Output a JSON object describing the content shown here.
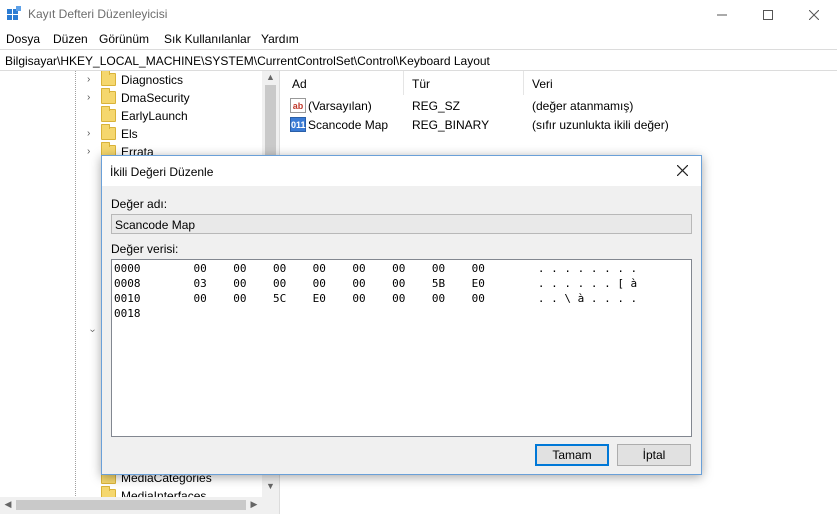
{
  "window": {
    "title": "Kayıt Defteri Düzenleyicisi",
    "controls": [
      "minimize-icon",
      "maximize-icon",
      "close-icon"
    ]
  },
  "menu": [
    "Dosya",
    "Düzen",
    "Görünüm",
    "Sık Kullanılanlar",
    "Yardım"
  ],
  "address": "Bilgisayar\\HKEY_LOCAL_MACHINE\\SYSTEM\\CurrentControlSet\\Control\\Keyboard Layout",
  "tree": {
    "items_top": [
      "Diagnostics",
      "DmaSecurity",
      "EarlyLaunch",
      "Els",
      "Errata"
    ],
    "items_bottom": [
      "MediaCategories",
      "MediaInterfaces"
    ]
  },
  "values": {
    "columns": [
      "Ad",
      "Tür",
      "Veri"
    ],
    "rows": [
      {
        "icon": "string-value-icon",
        "icon_text": "ab",
        "name": "(Varsayılan)",
        "type": "REG_SZ",
        "data": "(değer atanmamış)"
      },
      {
        "icon": "binary-value-icon",
        "icon_text": "011",
        "name": "Scancode Map",
        "type": "REG_BINARY",
        "data": "(sıfır uzunlukta ikili değer)"
      }
    ]
  },
  "dialog": {
    "title": "İkili Değeri Düzenle",
    "name_label": "Değer adı:",
    "name_value": "Scancode Map",
    "data_label": "Değer verisi:",
    "hex_lines": [
      "0000        00    00    00    00    00    00    00    00        . . . . . . . .",
      "0008        03    00    00    00    00    00    5B    E0        . . . . . . [ à",
      "0010        00    00    5C    E0    00    00    00    00        . . \\ à . . . .",
      "0018"
    ],
    "ok_label": "Tamam",
    "cancel_label": "İptal"
  }
}
